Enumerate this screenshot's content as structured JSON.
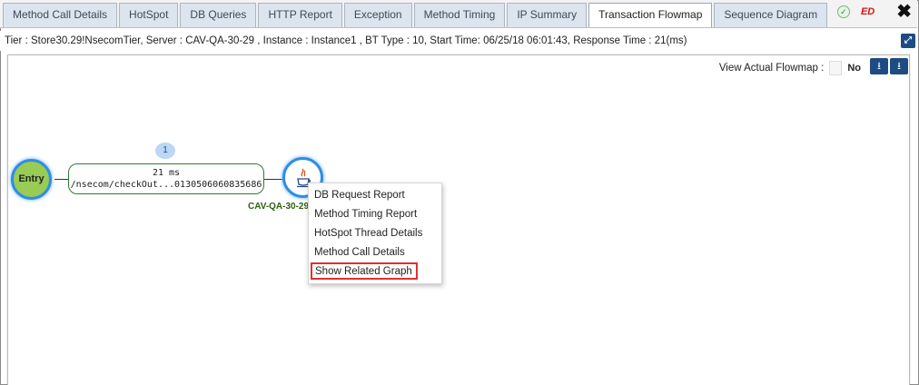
{
  "tabs": [
    {
      "label": "Method Call Details",
      "active": false
    },
    {
      "label": "HotSpot",
      "active": false
    },
    {
      "label": "DB Queries",
      "active": false
    },
    {
      "label": "HTTP Report",
      "active": false
    },
    {
      "label": "Exception",
      "active": false
    },
    {
      "label": "Method Timing",
      "active": false
    },
    {
      "label": "IP Summary",
      "active": false
    },
    {
      "label": "Transaction Flowmap",
      "active": true
    },
    {
      "label": "Sequence Diagram",
      "active": false
    }
  ],
  "toolbar": {
    "ed_label": "ED",
    "close_glyph": "✖",
    "status_glyph": "✓"
  },
  "info": {
    "text": "Tier : Store30.29!NsecomTier,  Server : CAV-QA-30-29 ,  Instance : Instance1 ,  BT Type : 10, Start Time: 06/25/18 06:01:43, Response Time : 21(ms)"
  },
  "flowmap": {
    "toggle_label": "View Actual Flowmap :",
    "toggle_value": "No",
    "entry_label": "Entry",
    "call_count": "1",
    "call_time": "21 ms",
    "call_url": "/nsecom/checkOut...0130506060835686",
    "server_label": "CAV-QA-30-29"
  },
  "context_menu": {
    "items": [
      "DB Request Report",
      "Method Timing Report",
      "HotSpot Thread Details",
      "Method Call Details",
      "Show Related Graph"
    ],
    "highlighted_index": 4
  },
  "colors": {
    "accent": "#1d4c83",
    "node_border": "#2f8ee2",
    "entry_fill": "#98cc55",
    "highlight": "#e03030"
  }
}
